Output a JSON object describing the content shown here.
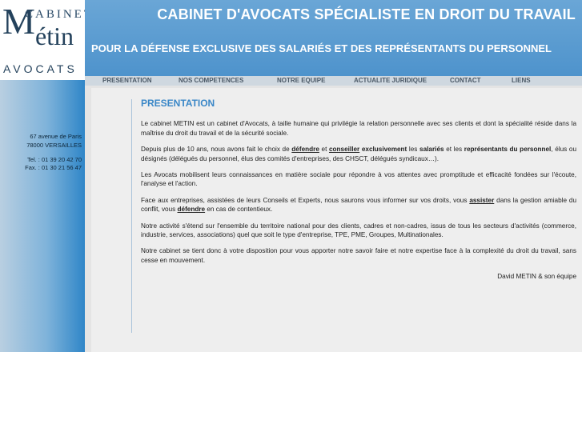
{
  "logo": {
    "cabinet": "CABINET",
    "m": "M",
    "etin": "étin",
    "avocats": "AVOCATS"
  },
  "address": {
    "street": "67 avenue de Paris",
    "city": "78000 VERSAILLES",
    "tel": "Tel. : 01 39 20 42 70",
    "fax": "Fax. : 01 30 21 56 47"
  },
  "header": {
    "title": "CABINET D'AVOCATS SPÉCIALISTE EN DROIT DU TRAVAIL",
    "subtitle": "POUR LA DÉFENSE EXCLUSIVE DES SALARIÉS ET DES REPRÉSENTANTS DU PERSONNEL"
  },
  "nav": [
    "PRESENTATION",
    "NOS COMPETENCES",
    "NOTRE EQUIPE",
    "ACTUALITE JURIDIQUE",
    "CONTACT",
    "LIENS"
  ],
  "content": {
    "title": "PRESENTATION",
    "p1": "Le cabinet METIN est un cabinet d'Avocats, à taille humaine qui privilégie la relation personnelle avec ses clients et dont la spécialité réside dans la maîtrise du droit du travail et de la sécurité sociale.",
    "p2": {
      "a": "Depuis plus de 10 ans, nous avons fait le choix de ",
      "defendre": "défendre",
      "b": " et ",
      "conseiller": "conseiller",
      "c": " exclusivement",
      "d": " les ",
      "salaries": "salariés",
      "e": " et les ",
      "representants": "représentants du personnel",
      "f": ", élus ou désignés (délégués du personnel, élus des comités d'entreprises, des CHSCT, délégués syndicaux…)."
    },
    "p3": "Les Avocats mobilisent leurs connaissances en matière sociale pour répondre à vos attentes avec promptitude et efficacité fondées sur l'écoute, l'analyse et l'action.",
    "p4": {
      "a": "Face aux entreprises, assistées de leurs Conseils et Experts, nous saurons vous informer sur vos droits, vous ",
      "assister": "assister",
      "b": " dans la gestion amiable du conflit, vous ",
      "defendre": "défendre",
      "c": " en cas de contentieux."
    },
    "p5": "Notre activité s'étend sur l'ensemble du territoire national pour des clients, cadres et non-cadres, issus de tous les secteurs d'activités (commerce, industrie, services, associations) quel que soit le type d'entreprise, TPE, PME, Groupes, Multinationales.",
    "p6": "Notre cabinet se tient donc à votre disposition pour vous apporter notre savoir faire et notre expertise face à la complexité du droit du travail, sans cesse en mouvement.",
    "signature": "David METIN & son équipe"
  }
}
